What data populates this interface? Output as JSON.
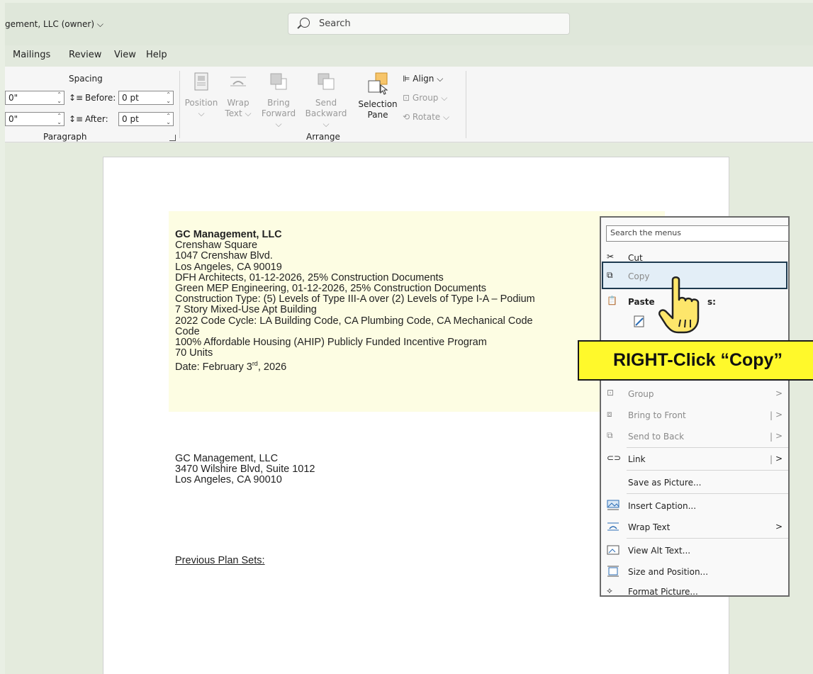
{
  "titlebar": {
    "owner": "gement, LLC (owner) ⌵",
    "search_placeholder": "Search"
  },
  "tabs": [
    "Mailings",
    "Review",
    "View",
    "Help"
  ],
  "ribbon": {
    "spacing_label": "Spacing",
    "indent_left": "0\"",
    "indent_right": "0\"",
    "before_label": "Before:",
    "before_value": "0 pt",
    "after_label": "After:",
    "after_value": "0 pt",
    "paragraph_label": "Paragraph",
    "arrange_label": "Arrange",
    "position": "Position",
    "wrap_text_1": "Wrap",
    "wrap_text_2": "Text ⌵",
    "bring_forward_1": "Bring",
    "bring_forward_2": "Forward ⌵",
    "send_backward_1": "Send",
    "send_backward_2": "Backward ⌵",
    "selection_pane_1": "Selection",
    "selection_pane_2": "Pane",
    "align": "Align ⌵",
    "group": "Group ⌵",
    "rotate": "Rotate ⌵"
  },
  "document": {
    "block1": [
      "GC Management, LLC",
      "Crenshaw Square",
      "1047 Crenshaw Blvd.",
      "Los Angeles, CA 90019",
      "DFH Architects, 01-12-2026, 25% Construction Documents",
      "Green MEP Engineering, 01-12-2026, 25% Construction Documents",
      "Construction Type: (5) Levels of Type III-A over (2) Levels of Type I-A – Podium",
      "7 Story Mixed-Use Apt Building",
      "2022 Code Cycle: LA Building Code, CA Plumbing Code, CA Mechanical Code",
      "Code",
      "100% Affordable Housing (AHIP) Publicly Funded Incentive Program",
      "70 Units"
    ],
    "date_prefix": "Date: February 3",
    "date_sup": "rd",
    "date_suffix": ", 2026",
    "block2": [
      "GC Management, LLC",
      "3470 Wilshire Blvd, Suite 1012",
      "Los Angeles, CA 90010"
    ],
    "previous_plan_sets": "Previous Plan Sets:"
  },
  "context_menu": {
    "search_placeholder": "Search the menus",
    "cut": "Cut",
    "copy": "Copy",
    "paste": "Paste",
    "paste_suffix": "s:",
    "group": "Group",
    "bring_to_front": "Bring to Front",
    "send_to_back": "Send to Back",
    "link": "Link",
    "save_as_picture": "Save as Picture...",
    "insert_caption": "Insert Caption...",
    "wrap_text": "Wrap Text",
    "view_alt_text": "View Alt Text...",
    "size_and_position": "Size and Position...",
    "format_picture": "Format Picture..."
  },
  "callout": "RIGHT-Click “Copy”",
  "colors": {
    "highlight": "#fdfde3",
    "callout": "#fff92b",
    "copy_highlight": "#e3eef7"
  }
}
